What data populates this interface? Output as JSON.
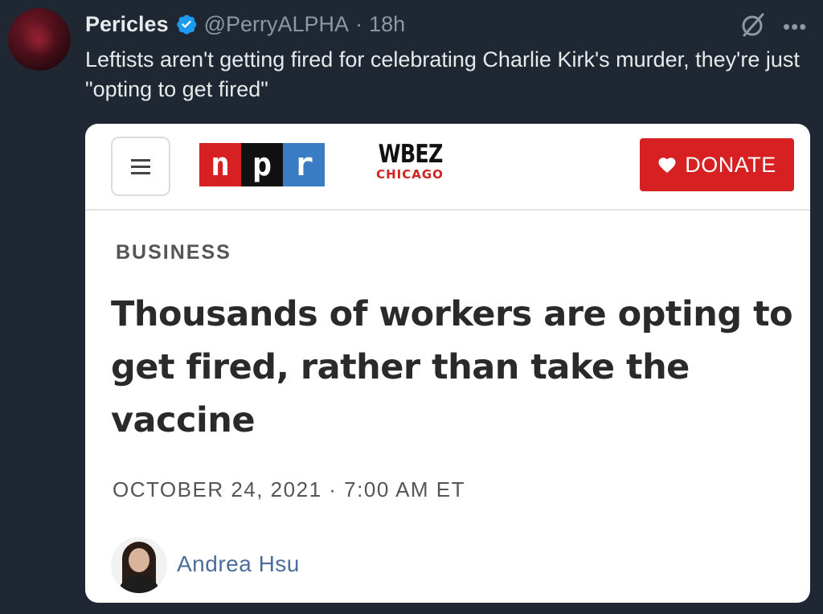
{
  "tweet": {
    "display_name": "Pericles",
    "handle": "@PerryALPHA",
    "separator": "·",
    "time": "18h",
    "text": "Leftists aren't getting fired for celebrating Charlie Kirk's murder, they're just \"opting to get fired\"",
    "icons": {
      "verified": "verified-badge-icon",
      "grok": "grok-icon",
      "more": "more-options-icon"
    },
    "colors": {
      "background": "#1e2732",
      "verified": "#1d9bf0"
    }
  },
  "card": {
    "npr_letters": [
      "n",
      "p",
      "r"
    ],
    "npr_colors": [
      "#d62021",
      "#111111",
      "#3a7cc3"
    ],
    "station_name": "WBEZ",
    "station_city": "CHICAGO",
    "donate_label": "DONATE",
    "donate_color": "#d62021",
    "section": "BUSINESS",
    "headline": "Thousands of workers are opting to get fired, rather than take the vaccine",
    "date": "OCTOBER 24, 2021",
    "date_separator": "·",
    "time": "7:00 AM ET",
    "author": "Andrea Hsu"
  }
}
